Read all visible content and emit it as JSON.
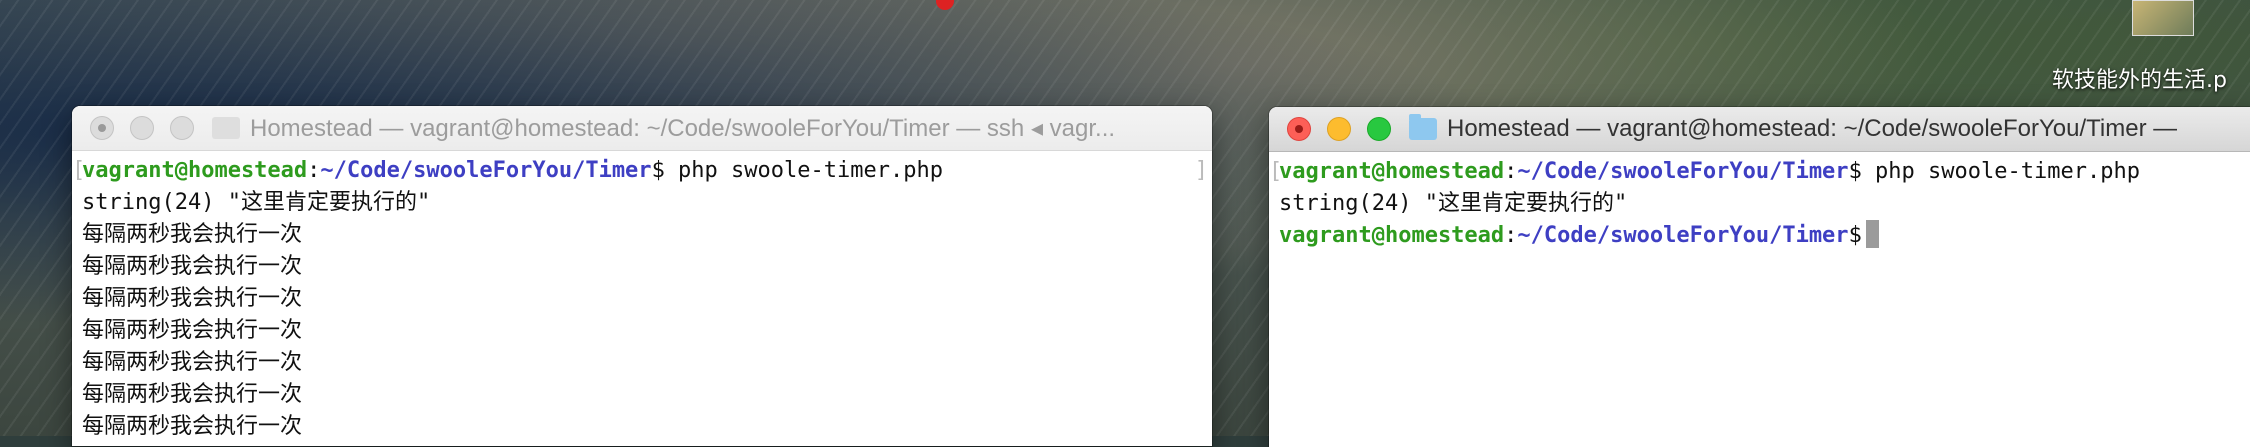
{
  "desktop": {
    "file_label": "软技能外的生活.p"
  },
  "left_window": {
    "title": "Homestead — vagrant@homestead: ~/Code/swooleForYou/Timer — ssh ◂ vagr...",
    "prompt_user": "vagrant@homestead",
    "prompt_sep": ":",
    "prompt_path": "~/Code/swooleForYou/Timer",
    "command": "$ php swoole-timer.php",
    "output_first": "string(24) \"这里肯定要执行的\"",
    "output_lines": [
      "每隔两秒我会执行一次",
      "每隔两秒我会执行一次",
      "每隔两秒我会执行一次",
      "每隔两秒我会执行一次",
      "每隔两秒我会执行一次",
      "每隔两秒我会执行一次",
      "每隔两秒我会执行一次"
    ]
  },
  "right_window": {
    "title": "Homestead — vagrant@homestead: ~/Code/swooleForYou/Timer —",
    "prompt_user": "vagrant@homestead",
    "prompt_sep": ":",
    "prompt_path": "~/Code/swooleForYou/Timer",
    "command": "$ php swoole-timer.php",
    "output_first": "string(24) \"这里肯定要执行的\"",
    "prompt2_user": "vagrant@homestead",
    "prompt2_sep": ":",
    "prompt2_path": "~/Code/swooleForYou/Timer",
    "prompt2_suffix": "$"
  }
}
